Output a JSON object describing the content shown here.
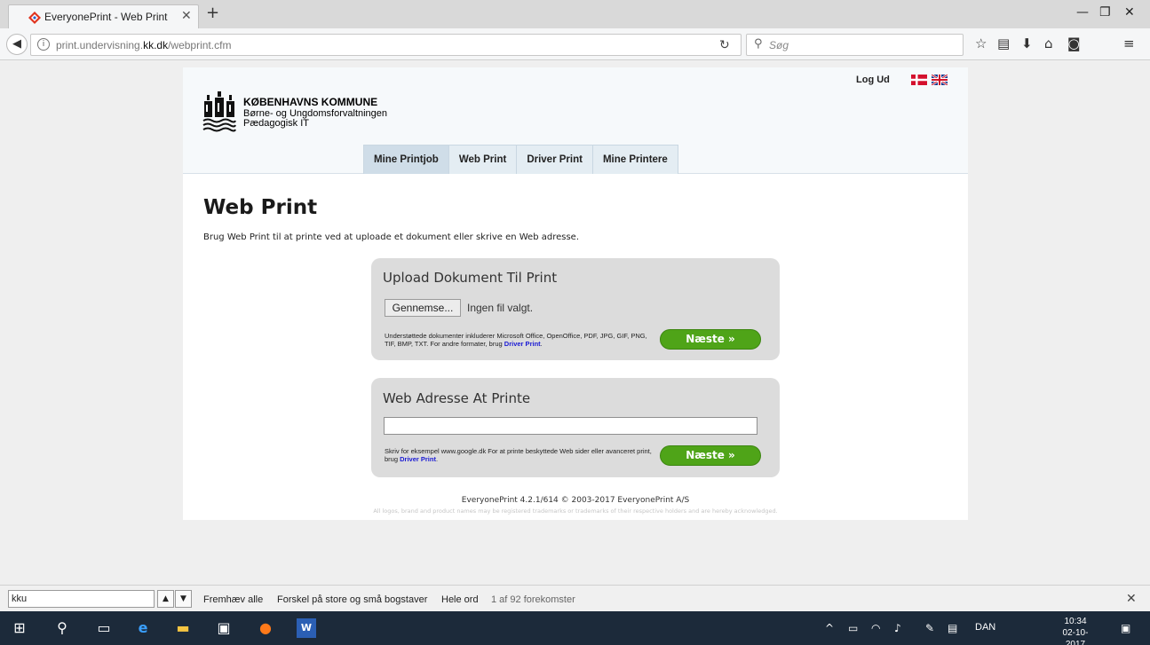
{
  "browser": {
    "tab_title": "EveryonePrint - Web Print",
    "url_prefix": "print.undervisning.",
    "url_domain": "kk.dk",
    "url_path": "/webprint.cfm",
    "search_placeholder": "Søg"
  },
  "header": {
    "org_name": "KØBENHAVNS KOMMUNE",
    "dept": "Børne- og Ungdomsforvaltningen",
    "unit": "Pædagogisk IT",
    "logout": "Log Ud",
    "menu": [
      "Mine Printjob",
      "Web Print",
      "Driver Print",
      "Mine Printere"
    ]
  },
  "main": {
    "title": "Web Print",
    "intro": "Brug Web Print til at printe ved at uploade et dokument eller skrive en Web adresse."
  },
  "upload": {
    "title": "Upload Dokument Til Print",
    "browse_label": "Gennemse...",
    "no_file": "Ingen fil valgt.",
    "help_text": "Understøttede dokumenter inkluderer Microsoft Office, OpenOffice, PDF, JPG, GIF, PNG, TIF, BMP, TXT. For andre formater, brug",
    "help_link": "Driver Print",
    "next_label": "Næste »"
  },
  "weburl": {
    "title": "Web Adresse At Printe",
    "input_value": "",
    "help_text": "Skriv for eksempel www.google.dk For at printe beskyttede Web sider eller avanceret print, brug",
    "help_link": "Driver Print",
    "next_label": "Næste »"
  },
  "footer": {
    "version": "EveryonePrint 4.2.1/614 © 2003-2017 EveryonePrint A/S",
    "legal": "All logos, brand and product names may be registered trademarks or trademarks of their respective holders and are hereby acknowledged."
  },
  "findbar": {
    "query": "kku",
    "highlight_all": "Fremhæv alle",
    "match_case": "Forskel på store og små bogstaver",
    "whole_words": "Hele ord",
    "count": "1 af 92 forekomster"
  },
  "taskbar": {
    "lang": "DAN",
    "time": "10:34",
    "date": "02-10-2017"
  },
  "colors": {
    "accent_green": "#4fa418",
    "link_blue": "#1a1ad4",
    "taskbar": "#1c2a3a"
  }
}
